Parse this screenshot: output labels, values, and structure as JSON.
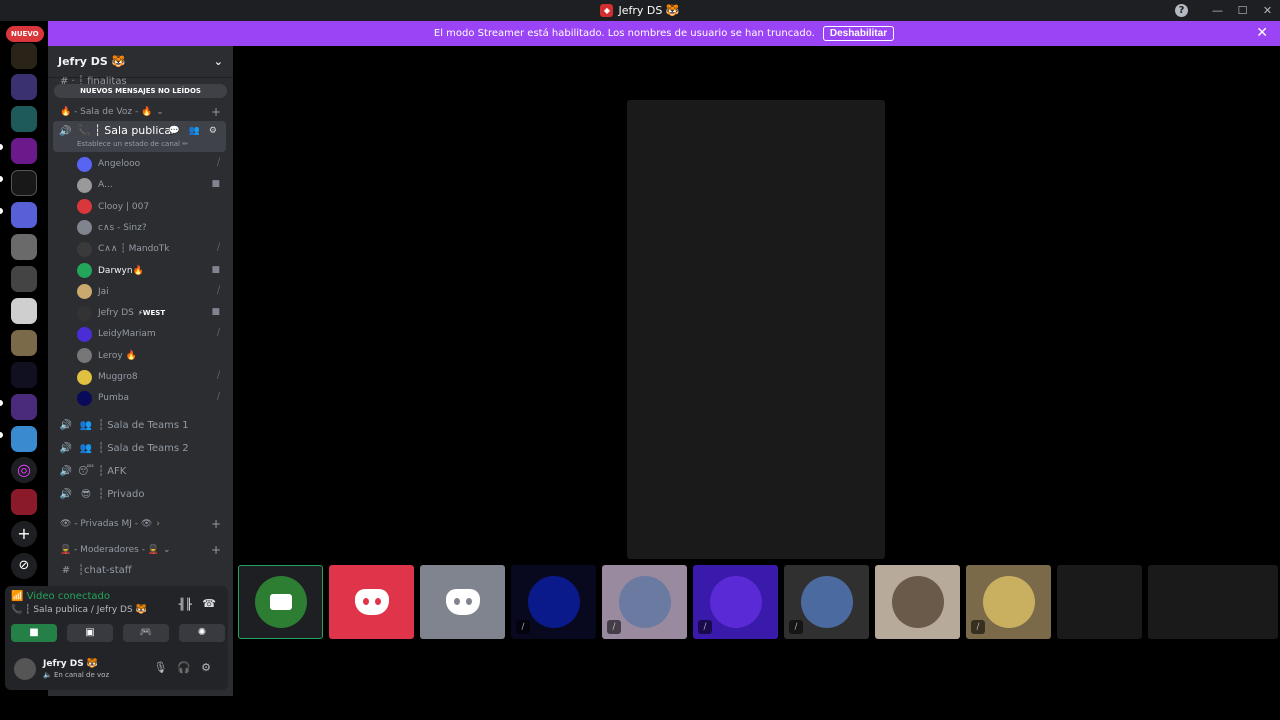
{
  "window": {
    "title": "Jefry DS 🐯"
  },
  "banner": {
    "text": "El modo Streamer está habilitado. Los nombres de usuario se han truncado.",
    "button": "Deshabilitar"
  },
  "guilds": {
    "new_badge": "NUEVO"
  },
  "server": {
    "name": "Jefry DS 🐯",
    "ghost_channel": "#  ·  ┆ finalitas",
    "unread_pill": "NUEVOS MENSAJES NO LEÍDOS"
  },
  "categories": {
    "voice": "🔥 - Sala de Voz - 🔥",
    "privadas": "👁 - Privadas MJ - 👁",
    "moderadores": "💂 - Moderadores - 💂"
  },
  "active_channel": {
    "name": "📞 ┆ Sala publica",
    "status_hint": "Establece un estado de canal ✏"
  },
  "members": [
    {
      "name": "Angelooo",
      "icon": "deafened-icon",
      "color": "#5865f2"
    },
    {
      "name": "A...",
      "icon": "camera-icon",
      "color": "#999999"
    },
    {
      "name": "Clooy | 007",
      "icon": "",
      "color": "#da373c"
    },
    {
      "name": "c∧s - Sinz?",
      "icon": "",
      "color": "#80848e"
    },
    {
      "name": "C∧∧ ┆ MandoTk",
      "icon": "deafened-icon",
      "color": "#3a3a3a"
    },
    {
      "name": "Darwyn🔥",
      "icon": "camera-icon",
      "color": "#23a55a"
    },
    {
      "name": "Jai",
      "icon": "deafened-icon",
      "color": "#c9a96e"
    },
    {
      "name": "Jefry DS",
      "badge": "⚡WEST",
      "icon": "camera-icon",
      "color": "#333333"
    },
    {
      "name": "LeidyMariam",
      "icon": "deafened-icon",
      "color": "#4b2dd6"
    },
    {
      "name": "Leroy 🔥",
      "icon": "",
      "color": "#777777"
    },
    {
      "name": "Muggro8",
      "icon": "deafened-icon",
      "color": "#e0c040"
    },
    {
      "name": "Pumba",
      "icon": "deafened-icon",
      "color": "#0a0a5a"
    }
  ],
  "channels": [
    {
      "name": "┆ Sala de Teams 1",
      "icon": "👥"
    },
    {
      "name": "┆ Sala de Teams 2",
      "icon": "👥"
    },
    {
      "name": "┆ AFK",
      "icon": "😴"
    },
    {
      "name": "┆ Privado",
      "icon": "😎"
    }
  ],
  "text_channel": {
    "name": "┆chat-staff"
  },
  "voice_panel": {
    "status": "Video conectado",
    "channel": "📞 ┆ Sala publica / Jefry DS 🐯"
  },
  "user": {
    "name": "Jefry DS 🐯",
    "status": "🔈 En canal de voz"
  },
  "colors": {
    "accent": "#9b44f6",
    "connected": "#23a55a",
    "danger": "#da373c",
    "blurple": "#5865f2"
  }
}
